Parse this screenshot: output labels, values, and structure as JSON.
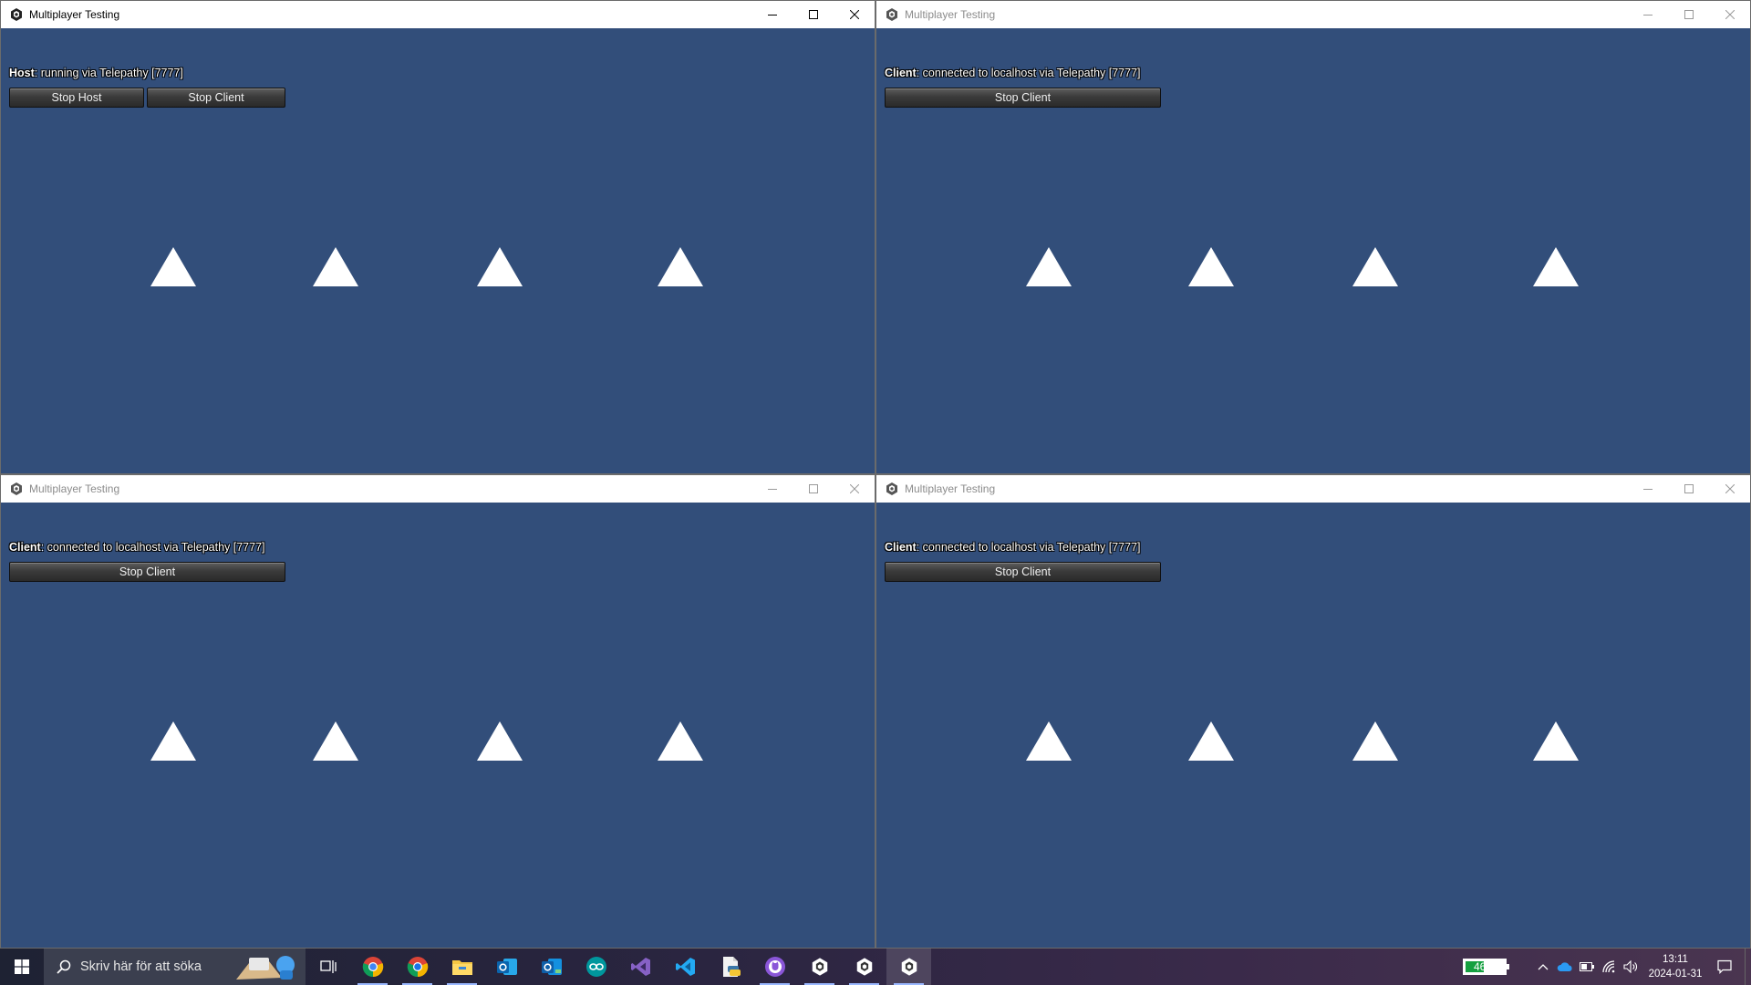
{
  "windows": [
    {
      "id": "top-left",
      "title": "Multiplayer Testing",
      "status_bold": "Host",
      "status_rest": ": running via Telepathy [7777]",
      "buttons": [
        "Stop Host",
        "Stop Client"
      ]
    },
    {
      "id": "top-right",
      "title": "Multiplayer Testing",
      "status_bold": "Client",
      "status_rest": ": connected to localhost via Telepathy [7777]",
      "buttons": [
        "Stop Client"
      ]
    },
    {
      "id": "bottom-left",
      "title": "Multiplayer Testing",
      "status_bold": "Client",
      "status_rest": ": connected to localhost via Telepathy [7777]",
      "buttons": [
        "Stop Client"
      ]
    },
    {
      "id": "bottom-right",
      "title": "Multiplayer Testing",
      "status_bold": "Client",
      "status_rest": ": connected to localhost via Telepathy [7777]",
      "buttons": [
        "Stop Client"
      ]
    }
  ],
  "taskbar": {
    "search_placeholder": "Skriv här för att söka",
    "apps": [
      "task-view-icon",
      "chrome-icon",
      "chrome-canary-icon",
      "file-explorer-icon",
      "outlook-icon",
      "outlook-new-icon",
      "arduino-icon",
      "visual-studio-icon",
      "vscode-icon",
      "python-file-icon",
      "github-desktop-icon",
      "unity-icon",
      "unity-icon",
      "unity-icon"
    ],
    "battery_percent": "46%",
    "battery_level": 0.46,
    "time": "13:11",
    "date": "2024-01-31"
  },
  "colors": {
    "game_background": "#324e7a",
    "title_bar": "#ffffff",
    "battery_fill": "#15a040"
  }
}
